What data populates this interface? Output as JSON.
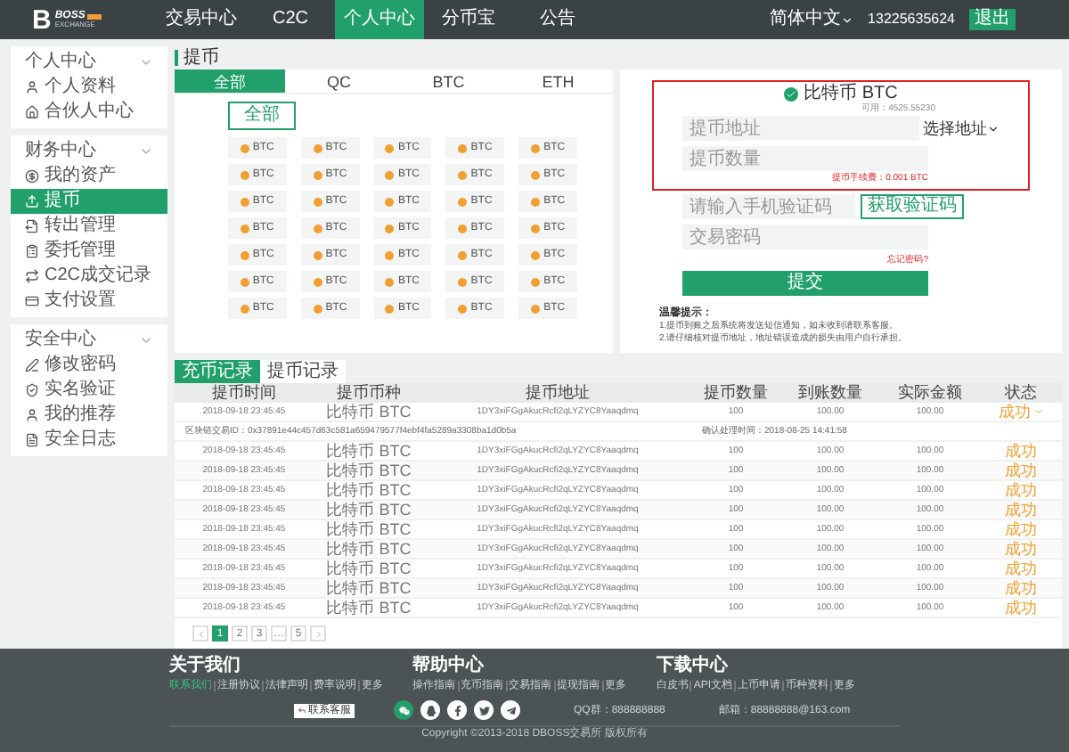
{
  "header": {
    "logo_mark": "B",
    "logo_name": "BOSS",
    "logo_sub": "EXCHANGE",
    "nav": [
      {
        "label": "交易中心",
        "selected": false
      },
      {
        "label": "C2C",
        "selected": false
      },
      {
        "label": "个人中心",
        "selected": true
      },
      {
        "label": "分币宝",
        "selected": false
      },
      {
        "label": "公告",
        "selected": false
      }
    ],
    "language": "简体中文",
    "phone": "13225635624",
    "logout": "退出"
  },
  "sidebar": {
    "groups": [
      {
        "title": "个人中心",
        "expanded": true,
        "items": [
          {
            "label": "个人资料",
            "selected": false
          },
          {
            "label": "合伙人中心",
            "selected": false
          }
        ]
      },
      {
        "title": "财务中心",
        "expanded": true,
        "items": [
          {
            "label": "我的资产",
            "selected": false
          },
          {
            "label": "提币",
            "selected": true
          },
          {
            "label": "转出管理",
            "selected": false
          },
          {
            "label": "委托管理",
            "selected": false
          },
          {
            "label": "C2C成交记录",
            "selected": false
          },
          {
            "label": "支付设置",
            "selected": false
          }
        ]
      },
      {
        "title": "安全中心",
        "expanded": true,
        "items": [
          {
            "label": "修改密码",
            "selected": false
          },
          {
            "label": "实名验证",
            "selected": false
          },
          {
            "label": "我的推荐",
            "selected": false
          },
          {
            "label": "安全日志",
            "selected": false
          }
        ]
      }
    ]
  },
  "page_title": "提币",
  "coin_panel": {
    "tabs": [
      {
        "label": "全部",
        "selected": true
      },
      {
        "label": "QC",
        "selected": false
      },
      {
        "label": "BTC",
        "selected": false
      },
      {
        "label": "ETH",
        "selected": false
      }
    ],
    "filter": "全部",
    "coins": [
      "BTC",
      "BTC",
      "BTC",
      "BTC",
      "BTC",
      "BTC",
      "BTC",
      "BTC",
      "BTC",
      "BTC",
      "BTC",
      "BTC",
      "BTC",
      "BTC",
      "BTC",
      "BTC",
      "BTC",
      "BTC",
      "BTC",
      "BTC",
      "BTC",
      "BTC",
      "BTC",
      "BTC",
      "BTC",
      "BTC",
      "BTC",
      "BTC",
      "BTC",
      "BTC",
      "BTC",
      "BTC",
      "BTC",
      "BTC",
      "BTC"
    ]
  },
  "withdraw_form": {
    "highlighted": true,
    "coin": "比特币 BTC",
    "available": "可用：4525.55230",
    "address": {
      "placeholder": "提币地址"
    },
    "address_select": "选择地址",
    "amount": {
      "placeholder": "提币数量"
    },
    "fee_note": "提币手续费：0.001 BTC",
    "code": {
      "placeholder": "请输入手机验证码"
    },
    "code_button": "获取验证码",
    "password": {
      "placeholder": "交易密码"
    },
    "forgot": "忘记密码?",
    "submit": "提交",
    "tips_title": "温馨提示：",
    "tips": [
      "1.提币到账之后系统将发送短信通知，如未收到请联系客服。",
      "2.请仔细核对提币地址，地址错误造成的损失由用户自行承担。"
    ]
  },
  "records": {
    "tabs": [
      {
        "label": "充币记录",
        "selected": true
      },
      {
        "label": "提币记录",
        "selected": false
      }
    ],
    "columns": [
      "提币时间",
      "提币币种",
      "提币地址",
      "提币数量",
      "到账数量",
      "实际金额",
      "状态"
    ],
    "rows": [
      {
        "kind": "record",
        "cells": [
          "2018-09-18 23:45:45",
          "比特币 BTC",
          "1DY3xiFGgAkucRcfi2qLYZYC8Yaaqdmq",
          "100",
          "100.00",
          "100.00"
        ],
        "status": "成功",
        "expanded": true
      },
      {
        "kind": "detail",
        "txid": "区块链交易ID：0x37891e44c457d63c581a659479577f4ebf4fa5289a3308ba1d0b5a",
        "time": "确认处理时间：2018-08-25 14:41:58"
      },
      {
        "kind": "record",
        "cells": [
          "2018-09-18 23:45:45",
          "比特币 BTC",
          "1DY3xiFGgAkucRcfi2qLYZYC8Yaaqdmq",
          "100",
          "100.00",
          "100.00"
        ],
        "status": "成功",
        "expanded": false
      },
      {
        "kind": "record",
        "cells": [
          "2018-09-18 23:45:45",
          "比特币 BTC",
          "1DY3xiFGgAkucRcfi2qLYZYC8Yaaqdmq",
          "100",
          "100.00",
          "100.00"
        ],
        "status": "成功",
        "expanded": false
      },
      {
        "kind": "record",
        "cells": [
          "2018-09-18 23:45:45",
          "比特币 BTC",
          "1DY3xiFGgAkucRcfi2qLYZYC8Yaaqdmq",
          "100",
          "100.00",
          "100.00"
        ],
        "status": "成功",
        "expanded": false
      },
      {
        "kind": "record",
        "cells": [
          "2018-09-18 23:45:45",
          "比特币 BTC",
          "1DY3xiFGgAkucRcfi2qLYZYC8Yaaqdmq",
          "100",
          "100.00",
          "100.00"
        ],
        "status": "成功",
        "expanded": false
      },
      {
        "kind": "record",
        "cells": [
          "2018-09-18 23:45:45",
          "比特币 BTC",
          "1DY3xiFGgAkucRcfi2qLYZYC8Yaaqdmq",
          "100",
          "100.00",
          "100.00"
        ],
        "status": "成功",
        "expanded": false
      },
      {
        "kind": "record",
        "cells": [
          "2018-09-18 23:45:45",
          "比特币 BTC",
          "1DY3xiFGgAkucRcfi2qLYZYC8Yaaqdmq",
          "100",
          "100.00",
          "100.00"
        ],
        "status": "成功",
        "expanded": false
      },
      {
        "kind": "record",
        "cells": [
          "2018-09-18 23:45:45",
          "比特币 BTC",
          "1DY3xiFGgAkucRcfi2qLYZYC8Yaaqdmq",
          "100",
          "100.00",
          "100.00"
        ],
        "status": "成功",
        "expanded": false
      },
      {
        "kind": "record",
        "cells": [
          "2018-09-18 23:45:45",
          "比特币 BTC",
          "1DY3xiFGgAkucRcfi2qLYZYC8Yaaqdmq",
          "100",
          "100.00",
          "100.00"
        ],
        "status": "成功",
        "expanded": false
      },
      {
        "kind": "record",
        "cells": [
          "2018-09-18 23:45:45",
          "比特币 BTC",
          "1DY3xiFGgAkucRcfi2qLYZYC8Yaaqdmq",
          "100",
          "100.00",
          "100.00"
        ],
        "status": "成功",
        "expanded": false
      }
    ],
    "pages": [
      {
        "label": "1",
        "selected": true
      },
      {
        "label": "2",
        "selected": false
      },
      {
        "label": "3",
        "selected": false
      },
      {
        "label": "…",
        "selected": false
      },
      {
        "label": "5",
        "selected": false
      }
    ]
  },
  "footer": {
    "columns": [
      {
        "title": "关于我们",
        "links": [
          {
            "label": "联系我们",
            "selected": true
          },
          {
            "label": "注册协议",
            "selected": false
          },
          {
            "label": "法律声明",
            "selected": false
          },
          {
            "label": "费率说明",
            "selected": false
          },
          {
            "label": "更多",
            "selected": false
          }
        ]
      },
      {
        "title": "帮助中心",
        "links": [
          {
            "label": "操作指南",
            "selected": false
          },
          {
            "label": "充币指南",
            "selected": false
          },
          {
            "label": "交易指南",
            "selected": false
          },
          {
            "label": "提现指南",
            "selected": false
          },
          {
            "label": "更多",
            "selected": false
          }
        ]
      },
      {
        "title": "下载中心",
        "links": [
          {
            "label": "白皮书",
            "selected": false
          },
          {
            "label": "API文档",
            "selected": false
          },
          {
            "label": "上币申请",
            "selected": false
          },
          {
            "label": "币种资料",
            "selected": false
          },
          {
            "label": "更多",
            "selected": false
          }
        ]
      }
    ],
    "app_button": "联系客服",
    "social": [
      {
        "kind": "wechat",
        "selected": true
      },
      {
        "kind": "qq",
        "selected": false
      },
      {
        "kind": "facebook",
        "selected": false
      },
      {
        "kind": "twitter",
        "selected": false
      },
      {
        "kind": "telegram",
        "selected": false
      }
    ],
    "qq_group": "QQ群：888888888",
    "email": "邮箱：88888888@163.com",
    "copyright": "Copyright ©2013-2018 DBOSS交易所 版权所有"
  }
}
